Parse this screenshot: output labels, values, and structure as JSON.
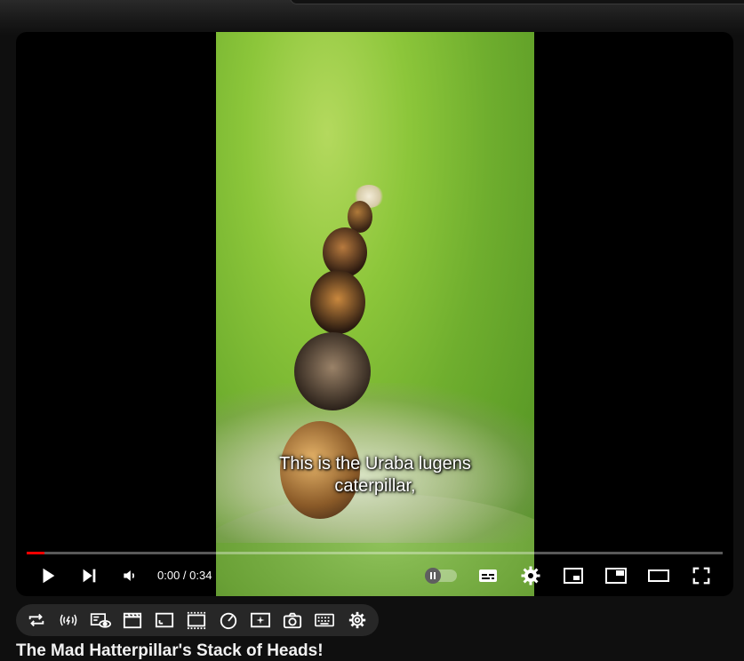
{
  "player": {
    "captions": [
      "This is the Uraba lugens",
      "caterpillar,"
    ],
    "progress_fraction": 0.025,
    "time": {
      "current": "0:00",
      "separator": " / ",
      "duration": "0:34"
    },
    "controls": [
      "play-icon",
      "next-icon",
      "volume-icon",
      "autoplay-toggle",
      "subtitles-icon",
      "settings-gear-icon",
      "miniplayer-icon",
      "theater-mode-icon",
      "widescreen-icon",
      "fullscreen-icon"
    ]
  },
  "extension_toolbar": {
    "icons": [
      "loop-icon",
      "audio-only-icon",
      "blur-watch-icon",
      "clapper-icon",
      "expand-frame-icon",
      "cinema-mode-icon",
      "playback-speed-icon",
      "enhance-icon",
      "screenshot-camera-icon",
      "keyboard-icon",
      "settings-gear-icon"
    ]
  },
  "video": {
    "title": "The Mad Hatterpillar's Stack of Heads!"
  },
  "colors": {
    "background": "#0f0f0f",
    "progress_played": "#ff0000",
    "toolbar": "#272727"
  }
}
